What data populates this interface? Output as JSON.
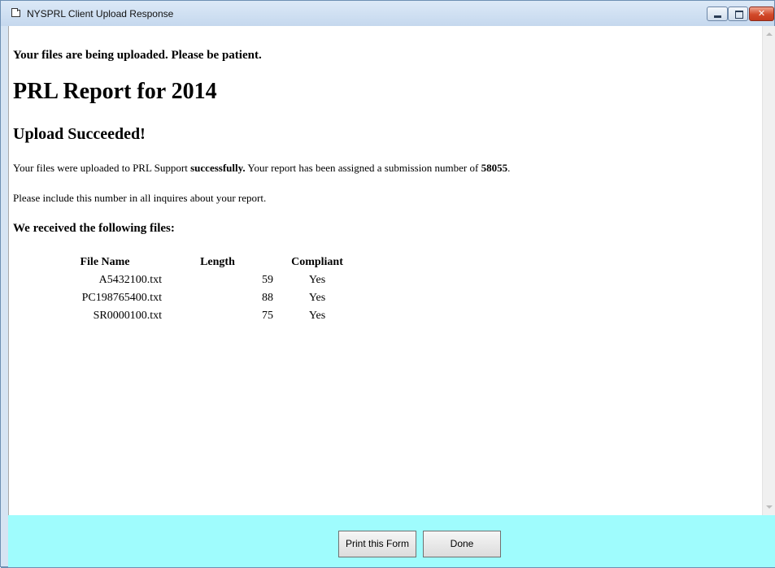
{
  "window": {
    "title": "NYSPRL Client Upload Response",
    "icon": "window-icon",
    "controls": [
      "minimize-icon",
      "maximize-icon",
      "close-icon"
    ]
  },
  "content": {
    "status_message": "Your files are being uploaded. Please be patient.",
    "report_title": "PRL Report for 2014",
    "result_heading": "Upload Succeeded!",
    "success_text": {
      "before": "Your files were uploaded to PRL Support ",
      "emphasis": "successfully.",
      "middle": " Your report has been assigned a submission number of ",
      "submission_number": "58055",
      "after": "."
    },
    "inquiry_note": "Please include this number in all inquires about your report.",
    "files_heading": "We received the following files:",
    "files_table": {
      "columns": [
        "File Name",
        "Length",
        "Compliant"
      ],
      "rows": [
        {
          "name": "A5432100.txt",
          "length": "59",
          "compliant": "Yes"
        },
        {
          "name": "PC198765400.txt",
          "length": "88",
          "compliant": "Yes"
        },
        {
          "name": "SR0000100.txt",
          "length": "75",
          "compliant": "Yes"
        }
      ]
    }
  },
  "footer": {
    "print_label": "Print this Form",
    "done_label": "Done",
    "background": "#9ffcfd"
  }
}
